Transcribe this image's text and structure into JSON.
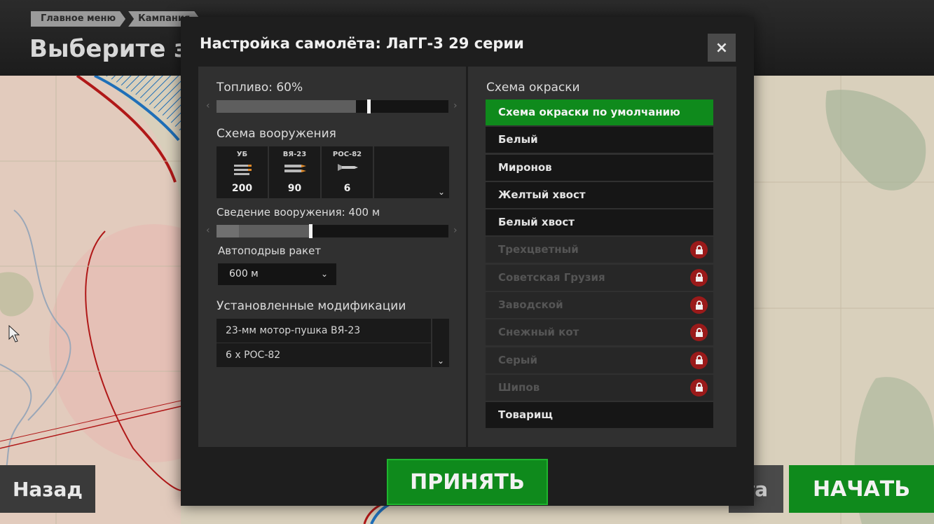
{
  "breadcrumb": [
    "Главное меню",
    "Кампания"
  ],
  "page_title": "Выберите за",
  "bottom_buttons": {
    "back": "Назад",
    "middle_fragment": "та",
    "start": "НАЧАТЬ"
  },
  "dialog": {
    "title": "Настройка самолёта: ЛаГГ-3 29 серии",
    "close_label": "×",
    "fuel": {
      "label": "Топливо: 60%",
      "value_percent": 60
    },
    "armament": {
      "label": "Схема вооружения",
      "weapons": [
        {
          "name": "УБ",
          "count": "200"
        },
        {
          "name": "ВЯ-23",
          "count": "90"
        },
        {
          "name": "РОС-82",
          "count": "6"
        }
      ]
    },
    "convergence": {
      "label": "Сведение вооружения: 400 м",
      "value_fraction": 0.4
    },
    "rocket_detonation": {
      "label": "Автоподрыв ракет",
      "value": "600 м"
    },
    "modifications": {
      "label": "Установленные модификации",
      "items": [
        "23-мм мотор-пушка ВЯ-23",
        "6 х РОС-82"
      ]
    },
    "paint": {
      "label": "Схема окраски",
      "schemes": [
        {
          "name": "Схема окраски по умолчанию",
          "state": "selected"
        },
        {
          "name": "Белый",
          "state": "available"
        },
        {
          "name": "Миронов",
          "state": "available"
        },
        {
          "name": "Желтый хвост",
          "state": "available"
        },
        {
          "name": "Белый хвост",
          "state": "available"
        },
        {
          "name": "Трехцветный",
          "state": "locked"
        },
        {
          "name": "Советская Грузия",
          "state": "locked"
        },
        {
          "name": "Заводской",
          "state": "locked"
        },
        {
          "name": "Снежный кот",
          "state": "locked"
        },
        {
          "name": "Серый",
          "state": "locked"
        },
        {
          "name": "Шипов",
          "state": "locked"
        },
        {
          "name": "Товарищ",
          "state": "available"
        }
      ]
    },
    "accept": "ПРИНЯТЬ"
  },
  "colors": {
    "accent_green": "#0f8a1c",
    "lock_red": "#9a1a1a",
    "map_base": "#d9d0bc",
    "front_red": "#b01818",
    "front_blue": "#1f6fb8"
  }
}
